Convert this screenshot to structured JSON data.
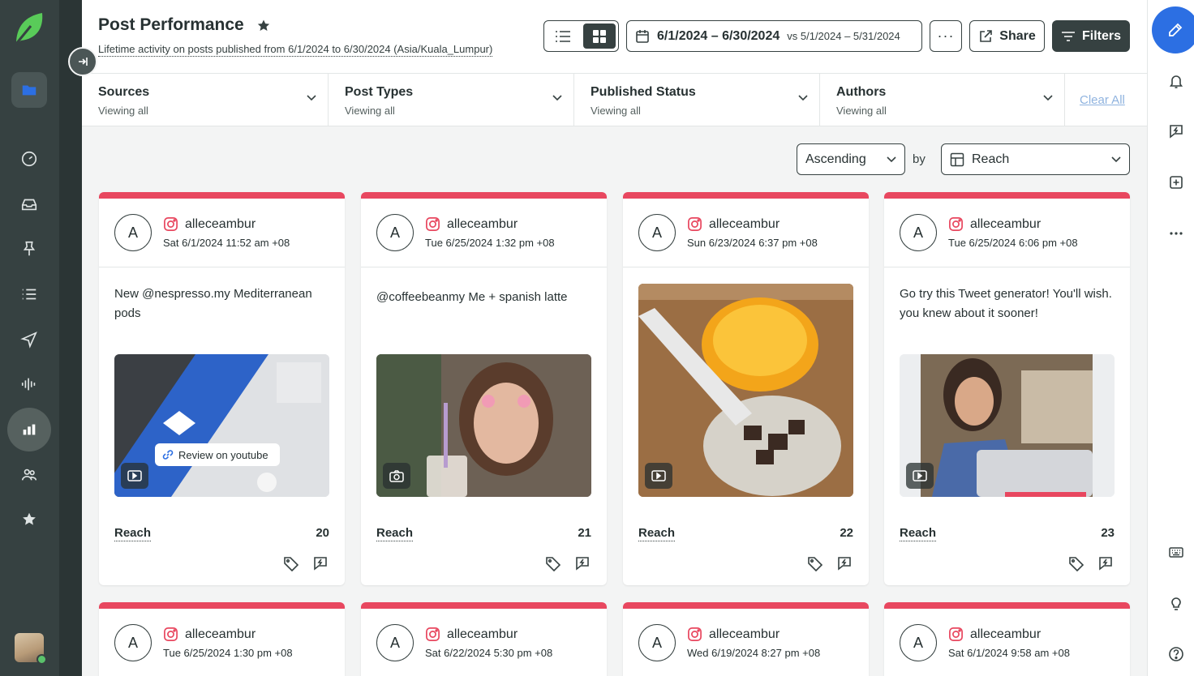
{
  "header": {
    "title": "Post Performance",
    "subtitle": "Lifetime activity on posts published from 6/1/2024 to 6/30/2024 (Asia/Kuala_Lumpur)",
    "date_range": "6/1/2024 – 6/30/2024",
    "vs_label": "vs",
    "compare_range": "5/1/2024 – 5/31/2024",
    "more_label": "···",
    "share_label": "Share",
    "filters_label": "Filters"
  },
  "filters": [
    {
      "label": "Sources",
      "value": "Viewing all"
    },
    {
      "label": "Post Types",
      "value": "Viewing all"
    },
    {
      "label": "Published Status",
      "value": "Viewing all"
    },
    {
      "label": "Authors",
      "value": "Viewing all"
    }
  ],
  "clear_all": "Clear All",
  "sort": {
    "order": "Ascending",
    "by_label": "by",
    "metric": "Reach"
  },
  "cards": [
    {
      "avatar": "A",
      "username": "alleceambur",
      "date": "Sat 6/1/2024 11:52 am +08",
      "text": "New @nespresso.my Mediterranean pods",
      "media_type": "video-icon",
      "metric_label": "Reach",
      "metric_value": "20",
      "overlay_text": "Review on youtube"
    },
    {
      "avatar": "A",
      "username": "alleceambur",
      "date": "Tue 6/25/2024 1:32 pm +08",
      "text": "@coffeebeanmy Me + spanish latte",
      "media_type": "camera-icon",
      "metric_label": "Reach",
      "metric_value": "21"
    },
    {
      "avatar": "A",
      "username": "alleceambur",
      "date": "Sun 6/23/2024 6:37 pm +08",
      "text": "",
      "media_type": "video-icon",
      "metric_label": "Reach",
      "metric_value": "22"
    },
    {
      "avatar": "A",
      "username": "alleceambur",
      "date": "Tue 6/25/2024 6:06 pm +08",
      "text": "Go try this Tweet generator! You'll wish. you knew about it sooner!",
      "media_type": "video-icon",
      "metric_label": "Reach",
      "metric_value": "23"
    },
    {
      "avatar": "A",
      "username": "alleceambur",
      "date": "Tue 6/25/2024 1:30 pm +08"
    },
    {
      "avatar": "A",
      "username": "alleceambur",
      "date": "Sat 6/22/2024 5:30 pm +08"
    },
    {
      "avatar": "A",
      "username": "alleceambur",
      "date": "Wed 6/19/2024 8:27 pm +08"
    },
    {
      "avatar": "A",
      "username": "alleceambur",
      "date": "Sat 6/1/2024 9:58 am +08"
    }
  ],
  "colors": {
    "accent_bar": "#e8475f",
    "nav_bg": "#364141",
    "brand_green": "#59cb59",
    "compose_blue": "#2c6fe3"
  }
}
